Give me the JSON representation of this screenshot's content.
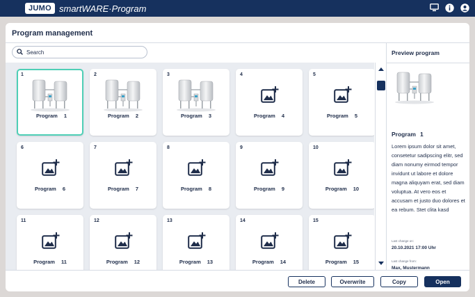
{
  "app": {
    "logo": "JUMO",
    "title": "smartWARE·Program",
    "icons": [
      "monitor-icon",
      "info-icon",
      "user-icon"
    ]
  },
  "panel": {
    "title": "Program management"
  },
  "search": {
    "placeholder": "Search"
  },
  "programs": [
    {
      "num": "1",
      "label": "Program",
      "index": "1",
      "has_image": true,
      "selected": true
    },
    {
      "num": "2",
      "label": "Program",
      "index": "2",
      "has_image": true
    },
    {
      "num": "3",
      "label": "Program",
      "index": "3",
      "has_image": true
    },
    {
      "num": "4",
      "label": "Program",
      "index": "4",
      "has_image": false
    },
    {
      "num": "5",
      "label": "Program",
      "index": "5",
      "has_image": false
    },
    {
      "num": "6",
      "label": "Program",
      "index": "6",
      "has_image": false
    },
    {
      "num": "7",
      "label": "Program",
      "index": "7",
      "has_image": false
    },
    {
      "num": "8",
      "label": "Program",
      "index": "8",
      "has_image": false
    },
    {
      "num": "9",
      "label": "Program",
      "index": "9",
      "has_image": false
    },
    {
      "num": "10",
      "label": "Program",
      "index": "10",
      "has_image": false
    },
    {
      "num": "11",
      "label": "Program",
      "index": "11",
      "has_image": false
    },
    {
      "num": "12",
      "label": "Program",
      "index": "12",
      "has_image": false
    },
    {
      "num": "13",
      "label": "Program",
      "index": "13",
      "has_image": false
    },
    {
      "num": "14",
      "label": "Program",
      "index": "14",
      "has_image": false
    },
    {
      "num": "15",
      "label": "Program",
      "index": "15",
      "has_image": false
    }
  ],
  "preview": {
    "title": "Preview program",
    "name": "Program",
    "name_index": "1",
    "description": "Lorem ipsum dolor sit amet, consetetur sadipscing elitr, sed diam nonumy eirmod tempor invidunt ut labore et dolore magna aliquyam erat, sed diam voluptua. At vero eos et accusam et justo duo dolores et ea rebum. Stet clita kasd",
    "last_change_on_label": "Last change on:",
    "last_change_on": "20.10.2021 17:00 Uhr",
    "last_change_from_label": "Last change from:",
    "last_change_from": "Max, Mustermann"
  },
  "buttons": {
    "delete": "Delete",
    "overwrite": "Overwrite",
    "copy": "Copy",
    "open": "Open"
  },
  "colors": {
    "brand": "#16315e",
    "selection": "#4ecfb6",
    "grid_bg": "#e9ecf1"
  }
}
